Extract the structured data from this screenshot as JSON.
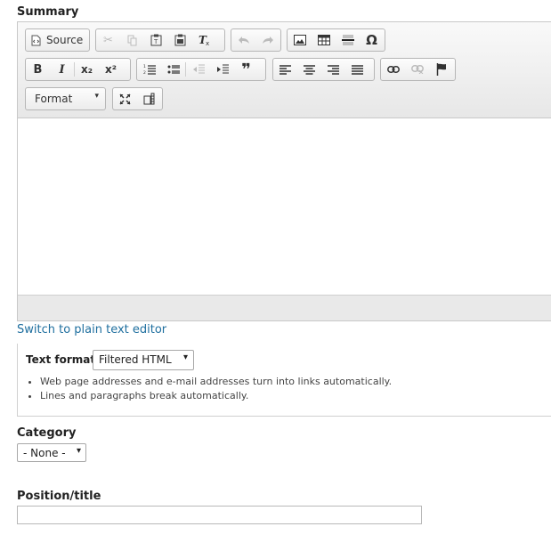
{
  "summary": {
    "label": "Summary"
  },
  "toolbar": {
    "source_label": "Source",
    "format_label": "Format",
    "format_arrow": "▾",
    "buttons": {
      "cut": "✂",
      "copy": "⧉",
      "paste": "📋",
      "bold": "B",
      "italic": "I",
      "subscript": "x₂",
      "superscript": "x²",
      "blockquote": "❞",
      "special_char": "Ω"
    },
    "icons": [
      "source-icon",
      "cut-icon",
      "copy-icon",
      "paste-text-icon",
      "paste-word-icon",
      "remove-format-icon",
      "undo-icon",
      "redo-icon",
      "image-icon",
      "table-icon",
      "horizontal-line-icon",
      "special-character-icon",
      "bold-icon",
      "italic-icon",
      "subscript-icon",
      "superscript-icon",
      "numbered-list-icon",
      "bulleted-list-icon",
      "outdent-icon",
      "indent-icon",
      "blockquote-icon",
      "align-left-icon",
      "align-center-icon",
      "align-right-icon",
      "justify-icon",
      "link-icon",
      "unlink-icon",
      "anchor-icon",
      "maximize-icon",
      "show-blocks-icon"
    ]
  },
  "switch_link": "Switch to plain text editor",
  "text_format": {
    "label": "Text format",
    "selected": "Filtered HTML",
    "arrow": "▾",
    "tips": [
      "Web page addresses and e-mail addresses turn into links automatically.",
      "Lines and paragraphs break automatically."
    ]
  },
  "category": {
    "label": "Category",
    "selected": "- None -",
    "arrow": "▾"
  },
  "position_title": {
    "label": "Position/title",
    "value": ""
  }
}
